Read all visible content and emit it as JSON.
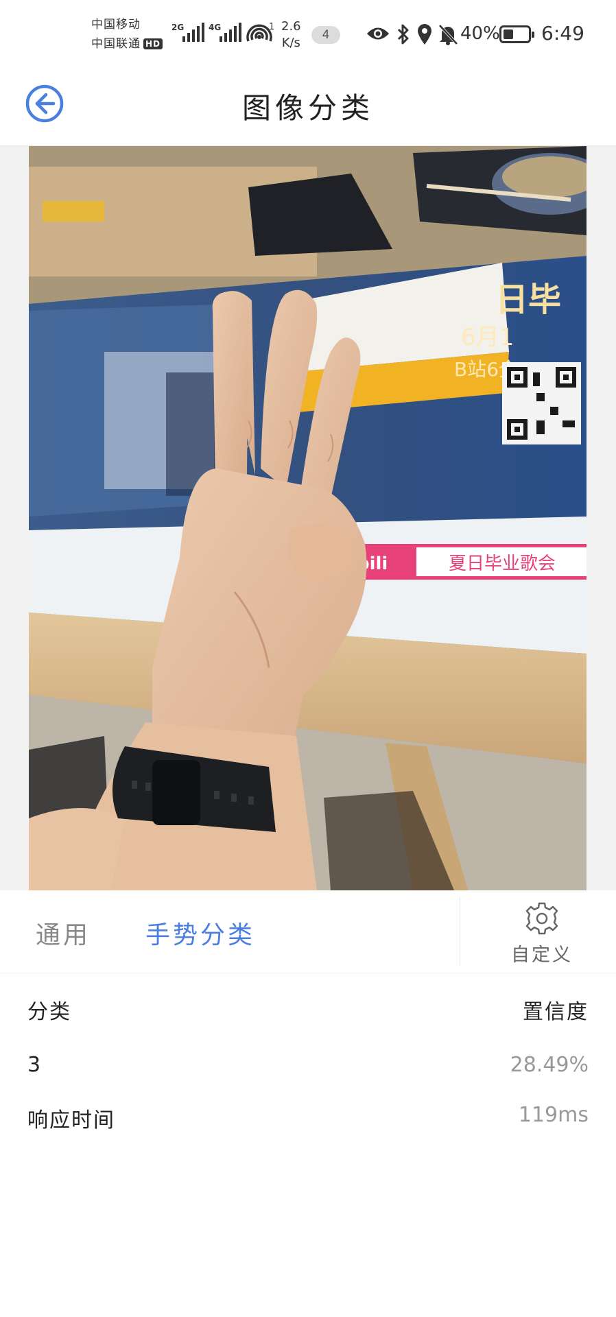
{
  "status_bar": {
    "carrier1": "中国移动",
    "carrier2": "中国联通",
    "hd_badge": "HD",
    "sig1_label": "2G",
    "sig2_label": "4G",
    "hotspot_count": "1",
    "speed_value": "2.6",
    "speed_unit": "K/s",
    "notification_count": "4",
    "battery_percent": "40%",
    "battery_level": 0.4,
    "time": "6:49"
  },
  "header": {
    "title": "图像分类"
  },
  "tabs": {
    "general": "通用",
    "gesture": "手势分类",
    "custom": "自定义"
  },
  "results": {
    "col_class": "分类",
    "col_confidence": "置信度",
    "class_value": "3",
    "confidence_value": "28.49%",
    "response_label": "响应时间",
    "response_value": "119ms"
  },
  "photo": {
    "poster_text": "夏日毕业歌会",
    "poster_brand": "bili",
    "poster_date": "6月1",
    "poster_venue": "B站6全",
    "poster_headline": "日毕"
  },
  "colors": {
    "accent": "#4a7fe0",
    "inactive_tab": "#888888",
    "value_gray": "#999999"
  }
}
